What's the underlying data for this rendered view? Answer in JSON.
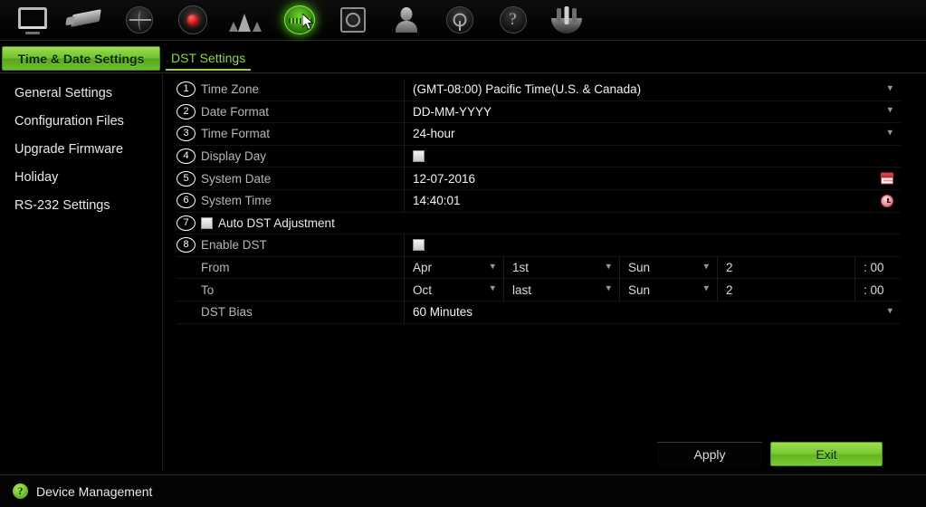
{
  "toolbar": {
    "items": [
      {
        "name": "live-view",
        "icon": "monitor-icon"
      },
      {
        "name": "camera",
        "icon": "camera-icon"
      },
      {
        "name": "playback",
        "icon": "globe-icon"
      },
      {
        "name": "record",
        "icon": "record-icon"
      },
      {
        "name": "alarm",
        "icon": "alarm-icon"
      },
      {
        "name": "network",
        "icon": "network-icon"
      },
      {
        "name": "hdd",
        "icon": "hdd-icon"
      },
      {
        "name": "user",
        "icon": "user-icon"
      },
      {
        "name": "maintenance",
        "icon": "maintenance-icon"
      },
      {
        "name": "help",
        "icon": "help-icon",
        "glyph": "?"
      },
      {
        "name": "shutdown",
        "icon": "shutdown-icon"
      }
    ]
  },
  "tabs": {
    "active": "Time & Date Settings",
    "inactive": "DST Settings"
  },
  "sidebar": {
    "items": [
      {
        "label": "General Settings"
      },
      {
        "label": "Configuration Files"
      },
      {
        "label": "Upgrade Firmware"
      },
      {
        "label": "Holiday"
      },
      {
        "label": "RS-232 Settings"
      }
    ]
  },
  "form": {
    "time_zone": {
      "num": "1",
      "label": "Time Zone",
      "value": "(GMT-08:00) Pacific Time(U.S. & Canada)"
    },
    "date_format": {
      "num": "2",
      "label": "Date Format",
      "value": "DD-MM-YYYY"
    },
    "time_format": {
      "num": "3",
      "label": "Time Format",
      "value": "24-hour"
    },
    "display_day": {
      "num": "4",
      "label": "Display Day",
      "checked": false
    },
    "system_date": {
      "num": "5",
      "label": "System Date",
      "value": "12-07-2016"
    },
    "system_time": {
      "num": "6",
      "label": "System Time",
      "value": "14:40:01"
    },
    "auto_dst": {
      "num": "7",
      "label": "Auto DST Adjustment",
      "checked": false
    },
    "enable_dst": {
      "num": "8",
      "label": "Enable DST",
      "checked": false
    },
    "from": {
      "label": "From",
      "month": "Apr",
      "week": "1st",
      "weekday": "Sun",
      "hour": "2",
      "minute": ": 00"
    },
    "to": {
      "label": "To",
      "month": "Oct",
      "week": "last",
      "weekday": "Sun",
      "hour": "2",
      "minute": ": 00"
    },
    "dst_bias": {
      "label": "DST Bias",
      "value": "60 Minutes"
    }
  },
  "buttons": {
    "apply": "Apply",
    "exit": "Exit"
  },
  "status": {
    "help_glyph": "?",
    "text": "Device Management"
  },
  "colors": {
    "accent_green": "#78c832",
    "tab_text_green": "#8ed34e",
    "background": "#000000",
    "label_gray": "#b6b6b6",
    "value_white": "#f0f0f0"
  }
}
